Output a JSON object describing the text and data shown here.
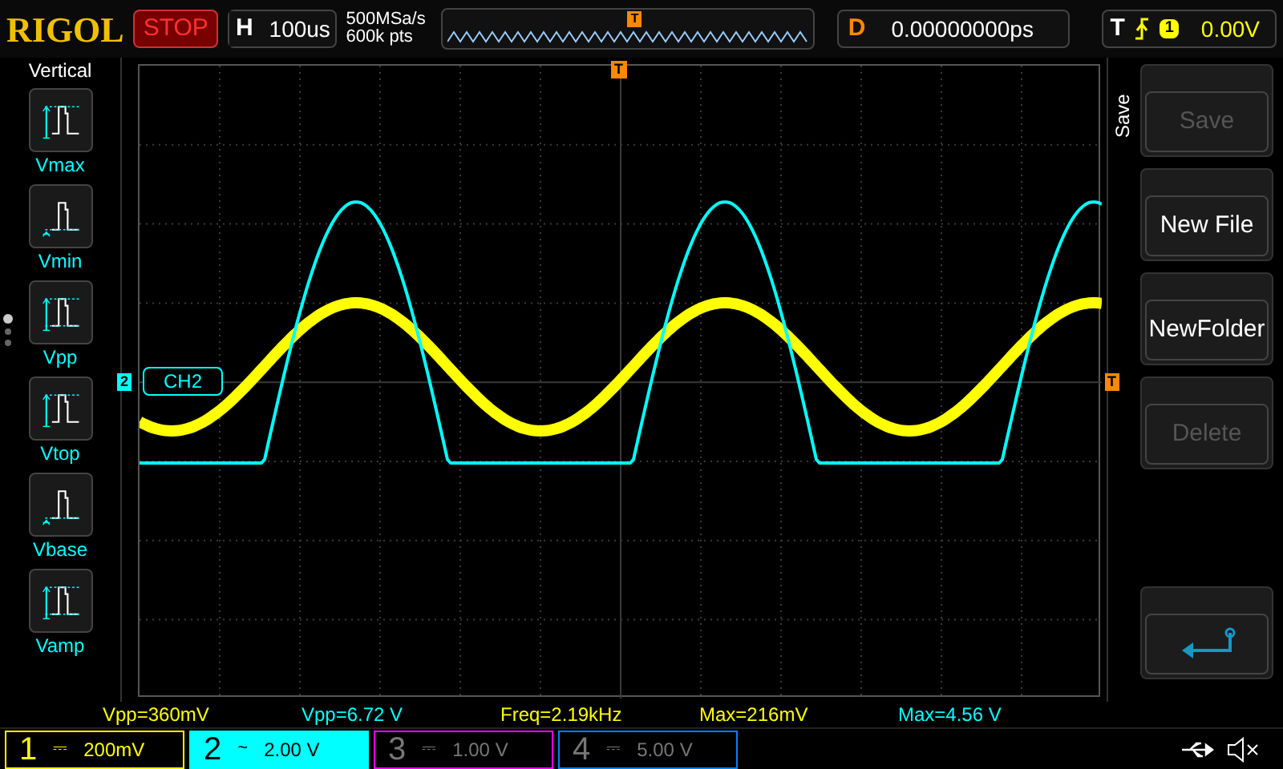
{
  "top_bar": {
    "logo": "RIGOL",
    "run_state": "STOP",
    "horizontal": {
      "label": "H",
      "timebase": "100us"
    },
    "sample_rate": "500MSa/s",
    "memory_depth": "600k pts",
    "trigger_marker": "T",
    "delay": {
      "label": "D",
      "value": "0.00000000ps"
    },
    "trigger": {
      "label": "T",
      "source": "1",
      "level": "0.00V"
    }
  },
  "left_menu": {
    "title": "Vertical",
    "items": [
      {
        "label": "Vmax",
        "kind": "max"
      },
      {
        "label": "Vmin",
        "kind": "min"
      },
      {
        "label": "Vpp",
        "kind": "pp"
      },
      {
        "label": "Vtop",
        "kind": "top"
      },
      {
        "label": "Vbase",
        "kind": "base"
      },
      {
        "label": "Vamp",
        "kind": "amp"
      }
    ],
    "pages": [
      {
        "selected": true
      },
      {
        "selected": false
      },
      {
        "selected": false
      }
    ]
  },
  "screen": {
    "trigger_top": "T",
    "trigger_right": "T",
    "channel_marker": "2",
    "channel_label": "CH2"
  },
  "right_menu": {
    "title": "Save",
    "buttons": [
      {
        "label": "Save",
        "disabled": true,
        "kind": "text"
      },
      {
        "label": "New File",
        "disabled": false,
        "kind": "text"
      },
      {
        "label": "NewFolder",
        "disabled": false,
        "kind": "text"
      },
      {
        "label": "Delete",
        "disabled": true,
        "kind": "text"
      },
      {
        "kind": "back"
      }
    ]
  },
  "measurements": [
    {
      "text": "Vpp=360mV",
      "color": "#ffff00"
    },
    {
      "text": "Vpp=6.72 V",
      "color": "#00ffff"
    },
    {
      "text": "Freq=2.19kHz",
      "color": "#ffff00"
    },
    {
      "text": "Max=216mV",
      "color": "#ffff00"
    },
    {
      "text": "Max=4.56 V",
      "color": "#00ffff"
    }
  ],
  "channels": [
    {
      "number": "1",
      "coupling": "⎓",
      "scale": "200mV",
      "color": "#ffff00",
      "on": true,
      "selected": false
    },
    {
      "number": "2",
      "coupling": "~",
      "scale": "2.00 V",
      "color": "#00ffff",
      "on": true,
      "selected": true
    },
    {
      "number": "3",
      "coupling": "⎓",
      "scale": "1.00 V",
      "color": "#ff00ff",
      "on": false,
      "selected": false
    },
    {
      "number": "4",
      "coupling": "⎓",
      "scale": "5.00 V",
      "color": "#0080ff",
      "on": false,
      "selected": false
    }
  ]
}
